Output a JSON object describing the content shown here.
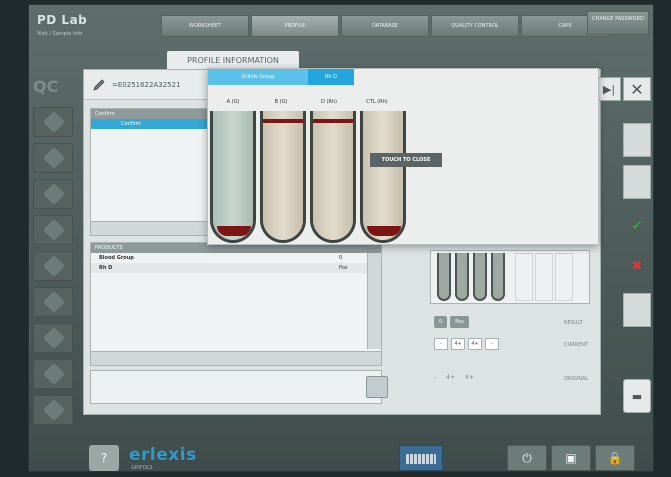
{
  "app": {
    "logo": "PD Lab",
    "user_info": "Visit / Sample info"
  },
  "top_nav": [
    "WORKSHEET",
    "PROFILE",
    "DATABASE",
    "QUALITY CONTROL",
    "CAPS"
  ],
  "change_password": "CHANGE PASSWORD",
  "sub_tab": "PROFILE INFORMATION",
  "left_rail": {
    "qc_label": "QC"
  },
  "sample": {
    "id": "=E0251622A32521"
  },
  "list": {
    "header": "Confirm",
    "selected": "Confirm"
  },
  "products": {
    "header": "PRODUCTS",
    "rows": [
      {
        "name": "Blood Group",
        "value": "0"
      },
      {
        "name": "Rh D",
        "value": "Pos"
      }
    ]
  },
  "result": {
    "value1": "0",
    "value2": "Pos",
    "label_result": "RESULT",
    "label_current": "CURRENT",
    "label_original": "ORIGINAL"
  },
  "grades": [
    "-",
    "4+",
    "4+",
    "-"
  ],
  "original_grades": [
    "-",
    "4+",
    "4+"
  ],
  "buttons": {
    "close_symbol": "✕",
    "nav_last_symbol": "▶|",
    "check_symbol": "✔",
    "cross_symbol": "✖",
    "save_symbol": "▬"
  },
  "footer": {
    "help": "?",
    "brand": "erlexis",
    "brand_sub": "GRIFOLS",
    "power": "⏻",
    "record": "▣",
    "lock": "🔒"
  },
  "modal": {
    "tab1": "Grifols Group",
    "tab2": "Rh D",
    "tube_labels": [
      "A (O)",
      "B (O)",
      "D (Rh)",
      "CTL (Rh)"
    ],
    "touch_to_close": "TOUCH TO CLOSE"
  },
  "colors": {
    "accent": "#22a6dd",
    "tab_light": "#5cc1e8",
    "pellet": "#7d1515",
    "check": "#3aa14a",
    "cross": "#d43c3c"
  }
}
